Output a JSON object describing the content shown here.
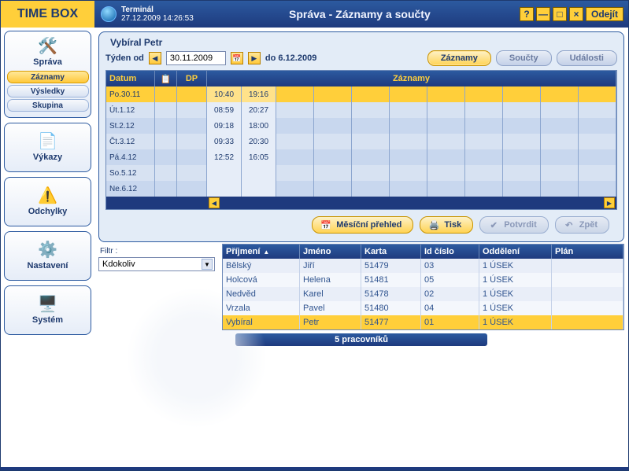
{
  "titlebar": {
    "logo": "TIME BOX",
    "terminal_label": "Terminál",
    "terminal_time": "27.12.2009 14:26:53",
    "title": "Správa - Záznamy a součty",
    "exit": "Odejít"
  },
  "sidebar": {
    "sprava": {
      "label": "Správa",
      "items": [
        "Záznamy",
        "Výsledky",
        "Skupina"
      ],
      "selected": 0
    },
    "vykazy": {
      "label": "Výkazy"
    },
    "odchylky": {
      "label": "Odchylky"
    },
    "nastaveni": {
      "label": "Nastavení"
    },
    "system": {
      "label": "Systém"
    }
  },
  "filter": {
    "label": "Filtr :",
    "value": "Kdokoliv"
  },
  "panel": {
    "person": "Vybíral Petr",
    "week_from_lbl": "Týden od",
    "date_from": "30.11.2009",
    "to_lbl": "do 6.12.2009",
    "tabs": {
      "zaznamy": "Záznamy",
      "soucty": "Součty",
      "udalosti": "Události"
    }
  },
  "sched": {
    "hdr": {
      "date": "Datum",
      "dp": "DP",
      "zaz": "Záznamy"
    },
    "rows": [
      {
        "d": "Po.30.11",
        "t1": "10:40",
        "t2": "19:16",
        "sel": true
      },
      {
        "d": "Út.1.12",
        "t1": "08:59",
        "t2": "20:27"
      },
      {
        "d": "St.2.12",
        "t1": "09:18",
        "t2": "18:00"
      },
      {
        "d": "Čt.3.12",
        "t1": "09:33",
        "t2": "20:30"
      },
      {
        "d": "Pá.4.12",
        "t1": "12:52",
        "t2": "16:05"
      },
      {
        "d": "So.5.12",
        "t1": "",
        "t2": ""
      },
      {
        "d": "Ne.6.12",
        "t1": "",
        "t2": ""
      }
    ]
  },
  "actions": {
    "mprehled": "Měsíční přehled",
    "tisk": "Tisk",
    "potvrdit": "Potvrdit",
    "zpet": "Zpět"
  },
  "emp": {
    "hdr": {
      "prijmeni": "Příjmení",
      "jmeno": "Jméno",
      "karta": "Karta",
      "id": "Id číslo",
      "odd": "Oddělení",
      "plan": "Plán"
    },
    "rows": [
      {
        "p": "Bělský",
        "j": "Jiří",
        "k": "51479",
        "i": "03",
        "o": "1 ÚSEK"
      },
      {
        "p": "Holcová",
        "j": "Helena",
        "k": "51481",
        "i": "05",
        "o": "1 ÚSEK"
      },
      {
        "p": "Nedvěd",
        "j": "Karel",
        "k": "51478",
        "i": "02",
        "o": "1 ÚSEK"
      },
      {
        "p": "Vrzala",
        "j": "Pavel",
        "k": "51480",
        "i": "04",
        "o": "1 ÚSEK"
      },
      {
        "p": "Vybíral",
        "j": "Petr",
        "k": "51477",
        "i": "01",
        "o": "1 ÚSEK",
        "sel": true
      }
    ]
  },
  "status": "5 pracovníků"
}
